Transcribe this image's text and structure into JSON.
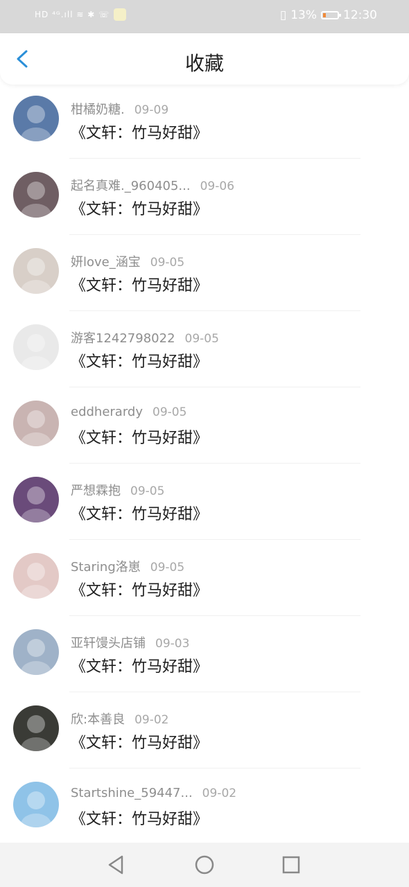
{
  "status_bar": {
    "left_icons": "HD ⁴ᴳ.ıll ≋ ✱ ☏",
    "battery": "13%",
    "battery_level": 0.13,
    "time": "12:30"
  },
  "header": {
    "title": "收藏",
    "back_icon": "chevron-left-icon"
  },
  "items": [
    {
      "user": "柑橘奶糖.",
      "date": "09-09",
      "title": "《文轩：竹马好甜》",
      "avatar_color": "#5a7aa8"
    },
    {
      "user": "起名真难._960405...",
      "date": "09-06",
      "title": "《文轩：竹马好甜》",
      "avatar_color": "#6f5e63"
    },
    {
      "user": "妍love_涵宝",
      "date": "09-05",
      "title": "《文轩：竹马好甜》",
      "avatar_color": "#d8cfc8"
    },
    {
      "user": "游客1242798022",
      "date": "09-05",
      "title": "《文轩：竹马好甜》",
      "avatar_color": "#e9e9e9"
    },
    {
      "user": "eddherardy",
      "date": "09-05",
      "title": "《文轩：竹马好甜》",
      "avatar_color": "#c9b4b2"
    },
    {
      "user": "严想霖抱",
      "date": "09-05",
      "title": "《文轩：竹马好甜》",
      "avatar_color": "#6a4b7a"
    },
    {
      "user": "Staring洛崽",
      "date": "09-05",
      "title": "《文轩：竹马好甜》",
      "avatar_color": "#e3c9c6"
    },
    {
      "user": "亚轩馒头店铺",
      "date": "09-03",
      "title": "《文轩：竹马好甜》",
      "avatar_color": "#9fb2c8"
    },
    {
      "user": "欣:本善良",
      "date": "09-02",
      "title": "《文轩：竹马好甜》",
      "avatar_color": "#3a3b36"
    },
    {
      "user": "Startshine_59447...",
      "date": "09-02",
      "title": "《文轩：竹马好甜》",
      "avatar_color": "#8fc3e8"
    }
  ],
  "nav": {
    "back": "triangle-back-icon",
    "home": "circle-home-icon",
    "recent": "square-recent-icon"
  },
  "colors": {
    "accent": "#2b8fd8",
    "status_bg": "#d8d8d8",
    "nav_bg": "#f3f3f3"
  }
}
